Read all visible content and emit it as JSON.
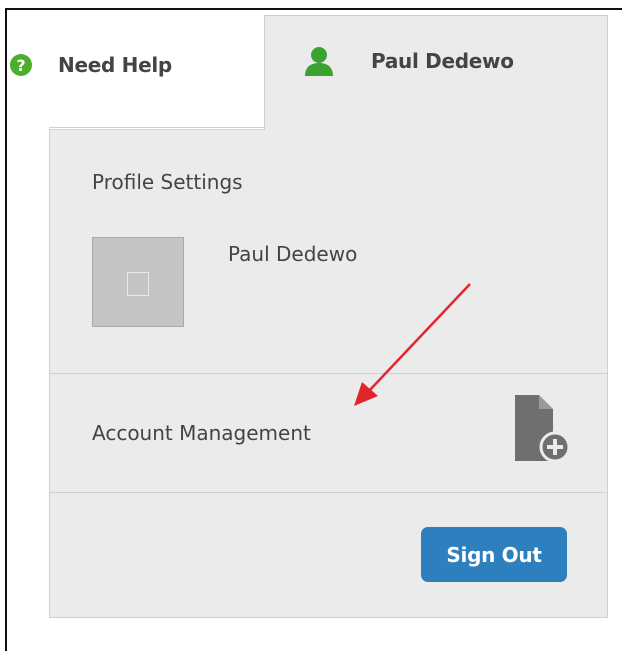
{
  "header": {
    "help_label": "Need Help",
    "help_icon_char": "?",
    "user_label": "Paul Dedewo"
  },
  "dropdown": {
    "profile_settings_label": "Profile Settings",
    "profile_name": "Paul Dedewo",
    "account_management_label": "Account Management",
    "sign_out_label": "Sign Out"
  },
  "colors": {
    "help_icon": "#4caf2c",
    "user_icon": "#3aa32f",
    "sign_out_button": "#2d7fbd",
    "annotation_arrow": "#e0262b",
    "panel_background": "#ebebeb"
  },
  "icons": {
    "help": "question-circle-icon",
    "user": "user-icon",
    "account": "document-add-icon",
    "avatar_placeholder": "image-placeholder-icon"
  }
}
